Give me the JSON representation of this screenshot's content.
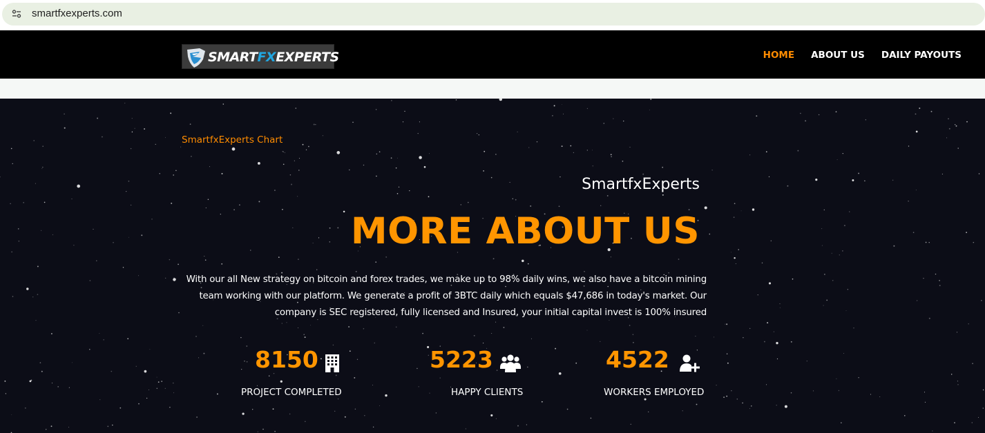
{
  "browser": {
    "url": "smartfxexperts.com"
  },
  "brand": {
    "logo_smart": "SMART",
    "logo_fx": "FX",
    "logo_experts": "EXPERTS",
    "accent_color": "#ff9500",
    "logo_fx_color": "#21a6e0"
  },
  "nav": {
    "items": [
      {
        "label": "HOME",
        "active": true
      },
      {
        "label": "ABOUT US",
        "active": false
      },
      {
        "label": "DAILY PAYOUTS",
        "active": false
      }
    ]
  },
  "hero": {
    "chart_link": "SmartfxExperts Chart",
    "subtitle": "SmartfxExperts",
    "headline": "MORE ABOUT US",
    "description": "With our all New strategy on bitcoin and forex trades, we make up to 98% daily wins, we also have a bitcoin mining team working with our platform. We generate a profit of 3BTC daily which equals $47,686 in today's market. Our company is SEC registered, fully licensed and Insured, your initial capital invest is 100% insured"
  },
  "stats": [
    {
      "value": "8150",
      "label": "PROJECT COMPLETED",
      "icon": "building-icon"
    },
    {
      "value": "5223",
      "label": "HAPPY CLIENTS",
      "icon": "users-icon"
    },
    {
      "value": "4522",
      "label": "WORKERS EMPLOYED",
      "icon": "user-plus-icon"
    }
  ]
}
